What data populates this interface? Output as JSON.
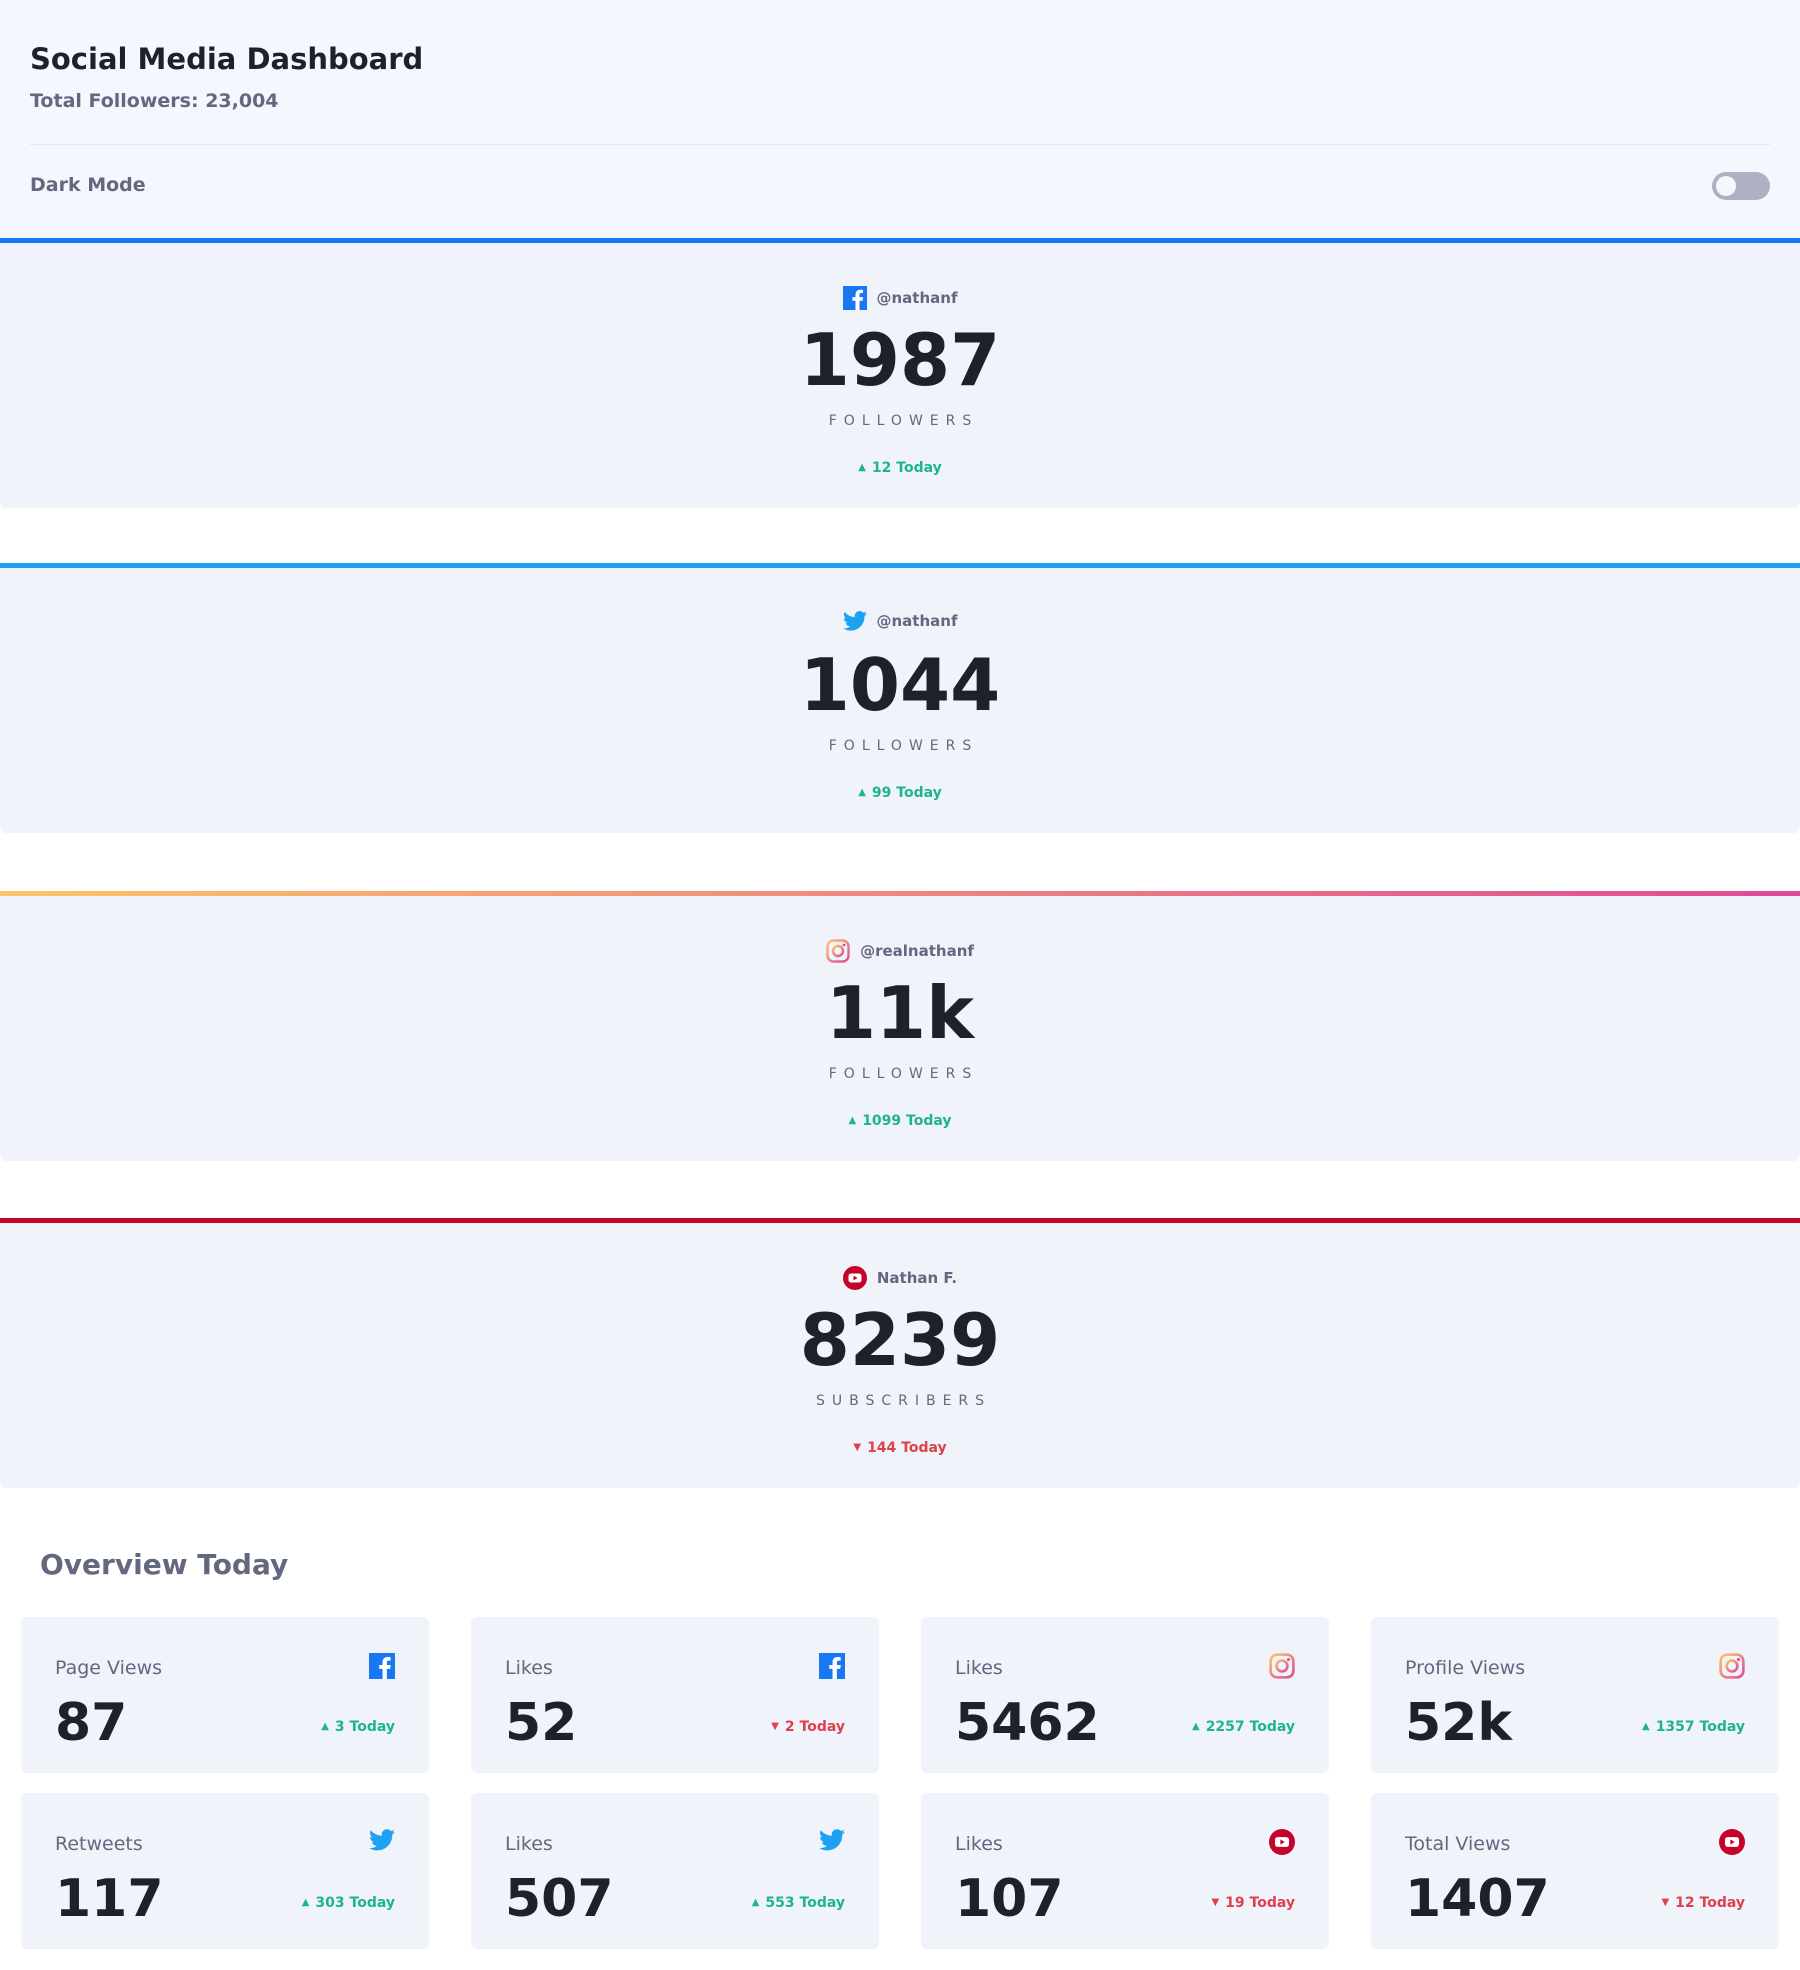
{
  "header": {
    "title": "Social Media Dashboard",
    "total_followers": "Total Followers: 23,004",
    "dark_mode_label": "Dark Mode",
    "dark_mode_on": false
  },
  "colors": {
    "facebook": "#1877f2",
    "twitter": "#1da1f2",
    "instagram_start": "#fdc468",
    "instagram_end": "#df4996",
    "youtube": "#c4032b",
    "up": "#1eb589",
    "down": "#dc414c"
  },
  "accounts": [
    {
      "platform": "facebook",
      "icon": "facebook-icon",
      "handle": "@nathanf",
      "count": "1987",
      "unit": "FOLLOWERS",
      "trend": "up",
      "today": "12 Today"
    },
    {
      "platform": "twitter",
      "icon": "twitter-icon",
      "handle": "@nathanf",
      "count": "1044",
      "unit": "FOLLOWERS",
      "trend": "up",
      "today": "99 Today"
    },
    {
      "platform": "instagram",
      "icon": "instagram-icon",
      "handle": "@realnathanf",
      "count": "11k",
      "unit": "FOLLOWERS",
      "trend": "up",
      "today": "1099 Today"
    },
    {
      "platform": "youtube",
      "icon": "youtube-icon",
      "handle": "Nathan F.",
      "count": "8239",
      "unit": "SUBSCRIBERS",
      "trend": "down",
      "today": "144 Today"
    }
  ],
  "overview": {
    "title": "Overview Today",
    "cards": [
      {
        "label": "Page Views",
        "platform": "facebook",
        "value": "87",
        "trend": "up",
        "today": "3 Today"
      },
      {
        "label": "Likes",
        "platform": "facebook",
        "value": "52",
        "trend": "down",
        "today": "2 Today"
      },
      {
        "label": "Likes",
        "platform": "instagram",
        "value": "5462",
        "trend": "up",
        "today": "2257 Today"
      },
      {
        "label": "Profile Views",
        "platform": "instagram",
        "value": "52k",
        "trend": "up",
        "today": "1357 Today"
      },
      {
        "label": "Retweets",
        "platform": "twitter",
        "value": "117",
        "trend": "up",
        "today": "303 Today"
      },
      {
        "label": "Likes",
        "platform": "twitter",
        "value": "507",
        "trend": "up",
        "today": "553 Today"
      },
      {
        "label": "Likes",
        "platform": "youtube",
        "value": "107",
        "trend": "down",
        "today": "19 Today"
      },
      {
        "label": "Total Views",
        "platform": "youtube",
        "value": "1407",
        "trend": "down",
        "today": "12 Today"
      }
    ]
  }
}
